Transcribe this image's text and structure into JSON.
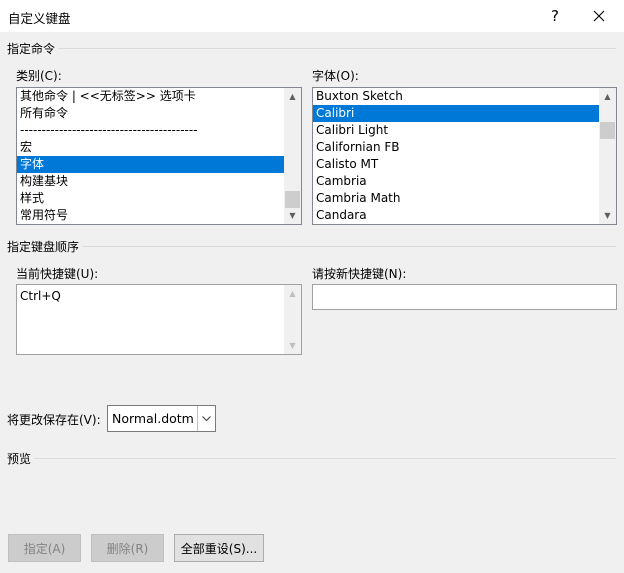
{
  "window": {
    "title": "自定义键盘",
    "help": "?",
    "close": "✕"
  },
  "specify_command": {
    "heading": "指定命令",
    "categories_label": "类别(C):",
    "categories": [
      "其他命令 | <<无标签>> 选项卡",
      "所有命令",
      "-----------------------------------------",
      "宏",
      "字体",
      "构建基块",
      "样式",
      "常用符号"
    ],
    "categories_selected": 4,
    "fonts_label": "字体(O):",
    "fonts": [
      "Buxton Sketch",
      "Calibri",
      "Calibri Light",
      "Californian FB",
      "Calisto MT",
      "Cambria",
      "Cambria Math",
      "Candara"
    ],
    "fonts_selected": 1
  },
  "key_sequence": {
    "heading": "指定键盘顺序",
    "current_keys_label": "当前快捷键(U):",
    "current_keys": [
      "Ctrl+Q"
    ],
    "new_key_label": "请按新快捷键(N):",
    "new_key_value": ""
  },
  "save_in": {
    "label": "将更改保存在(V):",
    "value": "Normal.dotm"
  },
  "preview": {
    "heading": "预览"
  },
  "buttons": {
    "assign": "指定(A)",
    "remove": "删除(R)",
    "reset_all": "全部重设(S)..."
  },
  "colors": {
    "selection": "#0078d7",
    "dialog_bg": "#f0f0f0"
  }
}
